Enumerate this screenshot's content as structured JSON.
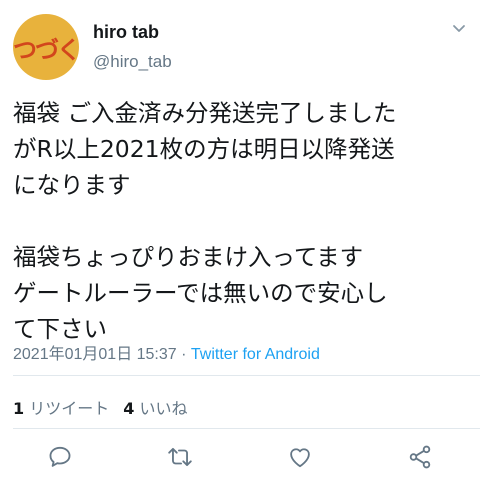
{
  "tweet": {
    "user": {
      "avatar_text": "つづく",
      "display_name": "hiro tab",
      "handle": "@hiro_tab"
    },
    "text": "福袋 ご入金済み分発送完了しました\nがR以上2021枚の方は明日以降発送\nになります\n\n福袋ちょっぴりおまけ入ってます\nゲートルーラーでは無いので安心し\nて下さい",
    "timestamp": "2021年01月01日 15:37",
    "separator": " · ",
    "source": "Twitter for Android",
    "retweets": {
      "count": "1",
      "label": "リツイート"
    },
    "likes": {
      "count": "4",
      "label": "いいね"
    }
  },
  "icons": [
    "chevron-down-icon",
    "reply-icon",
    "retweet-icon",
    "like-icon",
    "share-icon"
  ],
  "colors": {
    "link": "#1da1f2",
    "secondary": "#657786",
    "divider": "#e1e8ed",
    "avatar_bg": "#e8b23c",
    "avatar_text": "#d2461c"
  }
}
